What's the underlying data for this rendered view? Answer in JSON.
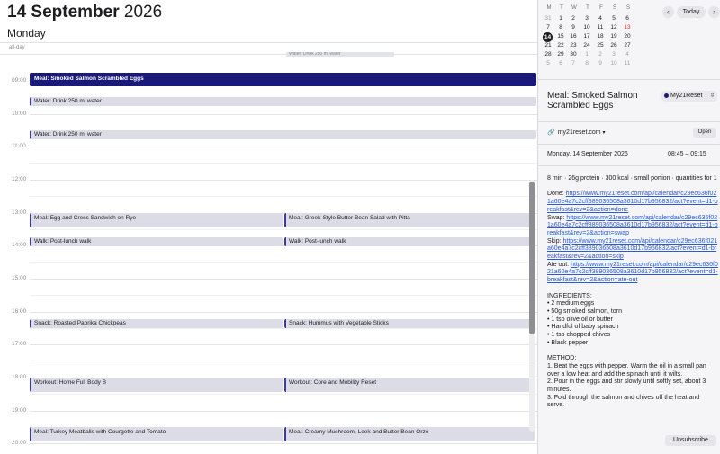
{
  "header": {
    "date_bold": "14 September",
    "year": "2026",
    "weekday": "Monday",
    "allday_label": "all-day"
  },
  "hours": [
    "09:00",
    "10:00",
    "11:00",
    "12:00",
    "13:00",
    "14:00",
    "15:00",
    "16:00",
    "17:00",
    "18:00",
    "19:00",
    "20:00"
  ],
  "events": {
    "ghost": "Water: Drink 250 ml water",
    "selected": "Meal: Smoked Salmon Scrambled Eggs",
    "water_1": "Water: Drink 250 ml water",
    "water_2": "Water: Drink 250 ml water",
    "lunch_a": "Meal: Egg and Cress Sandwich on Rye",
    "lunch_b": "Meal: Greek-Style Butter Bean Salad with Pitta",
    "walk_a": "Walk: Post-lunch walk",
    "walk_b": "Walk: Post-lunch walk",
    "snack_a": "Snack: Roasted Paprika Chickpeas",
    "snack_b": "Snack: Hummus with Vegetable Sticks",
    "workout_a": "Workout: Home Full Body B",
    "workout_b": "Workout: Core and Mobility Reset",
    "dinner_a": "Meal: Turkey Meatballs with Courgette and Tomato",
    "dinner_b": "Meal: Creamy Mushroom, Leek and Butter Bean Orzo"
  },
  "mini_calendar": {
    "weekdays": [
      "M",
      "T",
      "W",
      "T",
      "F",
      "S",
      "S"
    ],
    "weeks": [
      [
        "31",
        "1",
        "2",
        "3",
        "4",
        "5",
        "6"
      ],
      [
        "7",
        "8",
        "9",
        "10",
        "11",
        "12",
        "13"
      ],
      [
        "14",
        "15",
        "16",
        "17",
        "18",
        "19",
        "20"
      ],
      [
        "21",
        "22",
        "23",
        "24",
        "25",
        "26",
        "27"
      ],
      [
        "28",
        "29",
        "30",
        "1",
        "2",
        "3",
        "4"
      ],
      [
        "5",
        "6",
        "7",
        "8",
        "9",
        "10",
        "11"
      ]
    ],
    "prev_icon": "chevron-left-icon",
    "next_icon": "chevron-right-icon",
    "today_label": "Today"
  },
  "detail": {
    "title": "Meal: Smoked Salmon Scrambled Eggs",
    "calendar": "My21Reset",
    "calendar_color": "#1a1a7a",
    "url": "my21reset.com",
    "open_label": "Open",
    "date": "Monday, 14 September 2026",
    "time": "08:45 – 09:15",
    "summary": "8 min · 26g protein · 300 kcal · small portion · quantities for 1",
    "done_label": "Done:",
    "done_link": "https://www.my21reset.com/api/calendar/c29ec636f021a60e4a7c2cff389036508a3610d17b956832/act?event=d1-breakfast&rev=2&action=done",
    "swap_label": "Swap:",
    "swap_link": "https://www.my21reset.com/api/calendar/c29ec636f021a60e4a7c2cff389036508a3610d17b956832/act?event=d1-breakfast&rev=2&action=swap",
    "skip_label": "Skip:",
    "skip_link": "https://www.my21reset.com/api/calendar/c29ec636f021a60e4a7c2cff389036508a3610d17b956832/act?event=d1-breakfast&rev=2&action=skip",
    "ateout_label": "Ate out:",
    "ateout_link": "https://www.my21reset.com/api/calendar/c29ec636f021a60e4a7c2cff389036508a3610d17b956832/act?event=d1-breakfast&rev=2&action=ate-out",
    "ingredients_heading": "INGREDIENTS:",
    "ingredients": [
      "• 2 medium eggs",
      "• 50g smoked salmon, torn",
      "• 1 tsp olive oil or butter",
      "• Handful of baby spinach",
      "• 1 tsp chopped chives",
      "• Black pepper"
    ],
    "method_heading": "METHOD:",
    "method": [
      "1. Beat the eggs with pepper. Warm the oil in a small pan over a low heat and add the spinach until it wilts.",
      "2. Pour in the eggs and stir slowly until softly set, about 3 minutes.",
      "3. Fold through the salmon and chives off the heat and serve."
    ],
    "unsubscribe_label": "Unsubscribe"
  }
}
